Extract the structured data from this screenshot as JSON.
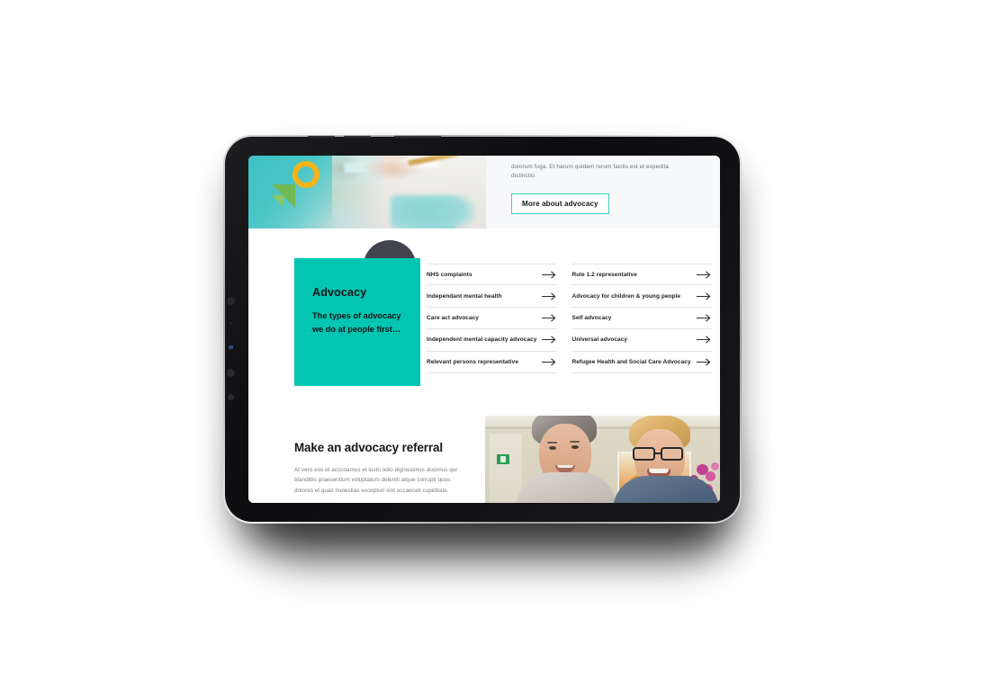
{
  "device": {
    "name": "tablet-mockup",
    "orientation": "landscape"
  },
  "top": {
    "lead_text": "dolorum fuga. Et harum quidem rerum facilis est et expedita distinctio.",
    "cta_label": "More about advocacy",
    "hero_image_alt": "hands writing on a document",
    "shapes": {
      "ring": "yellow-ring",
      "triangle_large": "green-triangle",
      "triangle_small": "green-triangle-small"
    }
  },
  "advocacy": {
    "card": {
      "heading": "Advocacy",
      "subheading": "The types of advocacy we do at people first…",
      "bubble": "speech-bubble"
    },
    "columns": [
      {
        "links": [
          {
            "label": "NHS complaints"
          },
          {
            "label": "Independant mental health"
          },
          {
            "label": "Care act advocacy"
          },
          {
            "label": "Independent mental capacity advocacy"
          },
          {
            "label": "Relevant persons representative"
          }
        ]
      },
      {
        "links": [
          {
            "label": "Rule 1.2 representative"
          },
          {
            "label": "Advocacy for children & young people"
          },
          {
            "label": "Self advocacy"
          },
          {
            "label": "Universal advocacy"
          },
          {
            "label": "Refugee Health and Social Care Advocacy"
          }
        ]
      }
    ]
  },
  "referral": {
    "heading": "Make an advocacy referral",
    "body": "At vero eos et accusamus et iusto odio dignissimos ducimus qui blanditiis praesentium voluptatum deleniti atque corrupti quos dolores et quas molestias excepturi sint occaecati cupiditate.",
    "photo_alt": "two smiling men in a living room"
  },
  "colors": {
    "teal": "#02c6b1",
    "teal_border": "#3ecfc0",
    "charcoal": "#42434d",
    "yellow": "#f6b316",
    "green": "#72b954",
    "text_dark": "#13161b",
    "text_muted": "#7b8085",
    "panel_bg": "#f7f8f9"
  }
}
